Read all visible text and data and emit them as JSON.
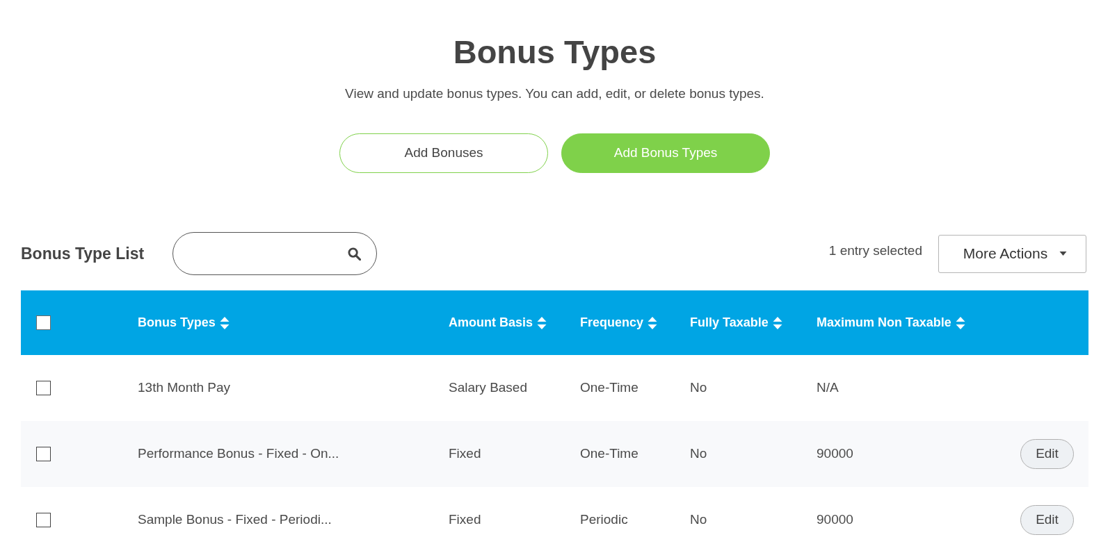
{
  "page": {
    "title": "Bonus Types",
    "subtitle": "View and update bonus types. You can add, edit, or delete bonus types."
  },
  "actions": [
    {
      "label": "Add Bonuses",
      "kind": "outline"
    },
    {
      "label": "Add Bonus Types",
      "kind": "filled"
    }
  ],
  "list_toolbar": {
    "title": "Bonus Type List",
    "selection_status": "1 entry selected",
    "more_actions": "More Actions"
  },
  "table": {
    "select_all": {
      "checked": false
    },
    "columns": [
      "Bonus Types",
      "Amount Basis",
      "Frequency",
      "Fully Taxable",
      "Maximum Non Taxable"
    ],
    "rows": [
      {
        "checked": false,
        "cells": [
          "13th Month Pay",
          "Salary Based",
          "One-Time",
          "No",
          "N/A"
        ]
      },
      {
        "checked": false,
        "cells": [
          "Performance Bonus - Fixed - On...",
          "Fixed",
          "One-Time",
          "No",
          "90000"
        ],
        "action": "Edit"
      },
      {
        "checked": false,
        "cells": [
          "Sample Bonus - Fixed - Periodi...",
          "Fixed",
          "Periodic",
          "No",
          "90000"
        ],
        "action": "Edit"
      }
    ]
  }
}
